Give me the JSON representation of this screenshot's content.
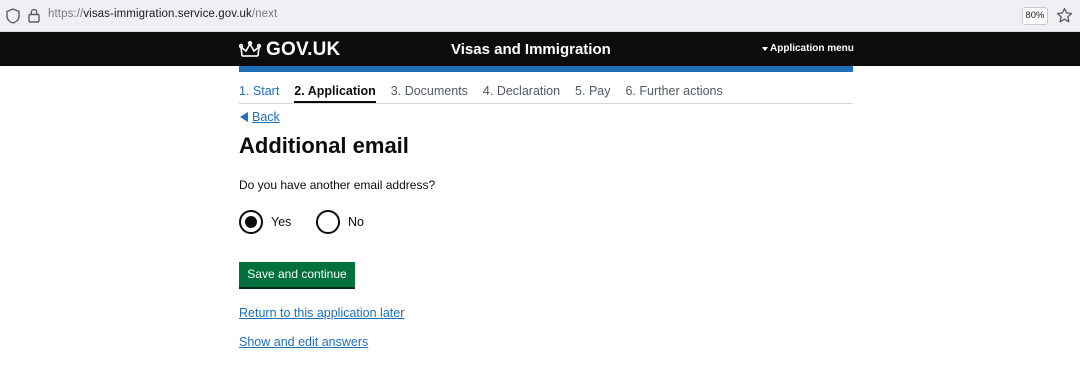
{
  "browser": {
    "url_scheme": "https://",
    "url_host": "visas-immigration.service.gov.uk",
    "url_path": "/next",
    "zoom": "80%"
  },
  "header": {
    "logo_text": "GOV.UK",
    "service_name": "Visas and Immigration",
    "menu_label": "Application menu"
  },
  "steps": [
    {
      "label": "1. Start",
      "state": "done"
    },
    {
      "label": "2. Application",
      "state": "current"
    },
    {
      "label": "3. Documents",
      "state": "upcoming"
    },
    {
      "label": "4. Declaration",
      "state": "upcoming"
    },
    {
      "label": "5. Pay",
      "state": "upcoming"
    },
    {
      "label": "6. Further actions",
      "state": "upcoming"
    }
  ],
  "back_label": "Back",
  "title": "Additional email",
  "question": "Do you have another email address?",
  "options": [
    {
      "label": "Yes",
      "selected": true
    },
    {
      "label": "No",
      "selected": false
    }
  ],
  "save_label": "Save and continue",
  "return_link": "Return to this application later",
  "show_link": "Show and edit answers",
  "colors": {
    "header_bg": "#0b0c0c",
    "accent_blue": "#1d70b8",
    "button_green": "#00703c"
  }
}
